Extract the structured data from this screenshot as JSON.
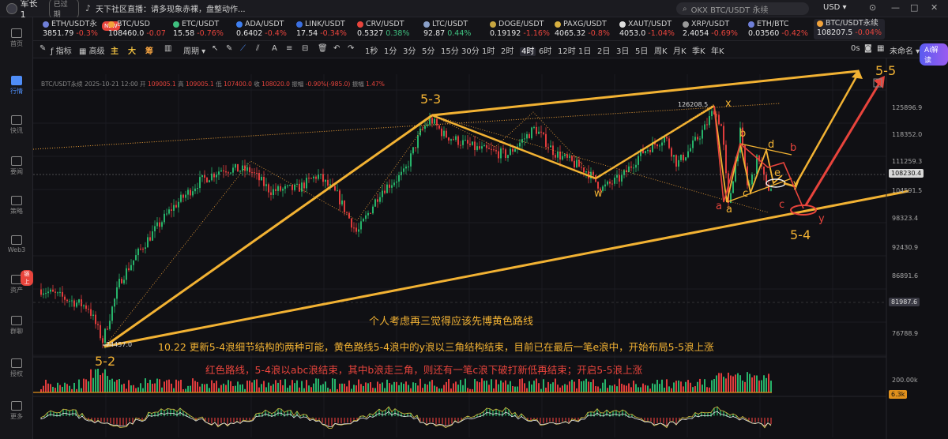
{
  "titlebar": {
    "user": "军长1",
    "expired": "已过期",
    "live": "天下社区直播：请多现象赤裸，盘整动作...",
    "search_placeholder": "OKX BTC/USDT 永续",
    "currency": "USD"
  },
  "sidebar": [
    {
      "label": "首页",
      "icon": "home-icon"
    },
    {
      "label": "行情",
      "icon": "chart-icon",
      "active": true
    },
    {
      "label": "快讯",
      "icon": "news-icon"
    },
    {
      "label": "要闻",
      "icon": "article-icon"
    },
    {
      "label": "策略",
      "icon": "strategy-icon"
    },
    {
      "label": "Web3",
      "icon": "web3-icon"
    },
    {
      "label": "资产",
      "icon": "wallet-icon",
      "badge": "链上"
    },
    {
      "label": "群聊",
      "icon": "chat-icon"
    },
    {
      "label": "授权",
      "icon": "auth-icon"
    },
    {
      "label": "更多",
      "icon": "more-icon"
    }
  ],
  "tickers": [
    {
      "sym": "ETH/USDT永",
      "price": "3851.79",
      "chg": "-0.3%",
      "dir": "dn",
      "color": "#6f7fd8",
      "badge": "NEW"
    },
    {
      "sym": "BTC/USD",
      "price": "108460.0",
      "chg": "-0.07",
      "dir": "dn",
      "color": "#f2a33a"
    },
    {
      "sym": "ETC/USDT",
      "price": "15.58",
      "chg": "-0.76%",
      "dir": "dn",
      "color": "#3fbf7f"
    },
    {
      "sym": "ADA/USDT",
      "price": "0.6402",
      "chg": "-0.4%",
      "dir": "dn",
      "color": "#3f7ff0"
    },
    {
      "sym": "LINK/USDT",
      "price": "17.54",
      "chg": "-0.34%",
      "dir": "dn",
      "color": "#3b6fe0"
    },
    {
      "sym": "CRV/USDT",
      "price": "0.5327",
      "chg": "0.38%",
      "dir": "up",
      "color": "#e8443c"
    },
    {
      "sym": "LTC/USDT",
      "price": "92.87",
      "chg": "0.44%",
      "dir": "up",
      "color": "#8aa0c8"
    },
    {
      "sym": "DOGE/USDT",
      "price": "0.19192",
      "chg": "-1.16%",
      "dir": "dn",
      "color": "#c8a640"
    },
    {
      "sym": "PAXG/USDT",
      "price": "4065.32",
      "chg": "-0.8%",
      "dir": "dn",
      "color": "#d8b040"
    },
    {
      "sym": "XAUT/USDT",
      "price": "4053.0",
      "chg": "-1.04%",
      "dir": "dn",
      "color": "#dddddd"
    },
    {
      "sym": "XRP/USDT",
      "price": "2.4054",
      "chg": "-0.69%",
      "dir": "dn",
      "color": "#999999"
    },
    {
      "sym": "ETH/BTC",
      "price": "0.03560",
      "chg": "-0.42%",
      "dir": "dn",
      "color": "#6f7fd8"
    },
    {
      "sym": "BTC/USDT永续",
      "price": "108207.5",
      "chg": "-0.04%",
      "dir": "dn",
      "color": "#f2a33a",
      "selected": true
    }
  ],
  "toolbar": {
    "indicators": "指标",
    "advanced": "高级",
    "multi": "多窗",
    "replay": "复盘",
    "main": "主",
    "big": "大",
    "chou": "筹",
    "timeframes": [
      "1秒",
      "1分",
      "3分",
      "5分",
      "15分",
      "30分",
      "1时",
      "2时",
      "4时",
      "6时",
      "12时",
      "1日",
      "2日",
      "3日",
      "5日",
      "周K",
      "月K",
      "季K",
      "年K"
    ],
    "selected_tf": "4时",
    "zero_s": "0s",
    "unnamed": "未命名",
    "ai": "Ai解读"
  },
  "chart": {
    "symbol": "BTC/USDT永续",
    "datetime": "2025-10-21 12:00",
    "open_label": "开",
    "open": "109005.1",
    "high_label": "高",
    "high": "109005.1",
    "low_label": "低",
    "low": "107400.0",
    "close_label": "收",
    "close": "108020.0",
    "amp_label": "振幅",
    "amp": "-0.90%(-985.0)",
    "range_label": "振幅",
    "range": "1.47%",
    "price_axis": [
      "125896.9",
      "118352.0",
      "111259.3",
      "104591.5",
      "98323.4",
      "92430.9",
      "86891.6",
      "76788.9"
    ],
    "current_price": "108230.4",
    "crosshair_price": "81987.6",
    "high_mark": "126208.5",
    "low_mark": "74457.0",
    "vol_axis": "200.00k",
    "vol_tag": "6.3k",
    "wave_labels": {
      "w53": "5-3",
      "w52": "5-2",
      "w54": "5-4",
      "w55": "5-5",
      "x": "x",
      "w": "w",
      "a1": "a",
      "a2": "a",
      "b1": "b",
      "b2": "b",
      "c1": "c",
      "c2": "c",
      "d": "d",
      "e": "e",
      "y1": "y",
      "y2": "y"
    },
    "note1": "个人考虑再三觉得应该先博黄色路线",
    "note2": "10.22 更新5-4浪细节结构的两种可能，黄色路线5-4浪中的y浪以三角结构结束，目前已在最后一笔e浪中，开始布局5-5浪上涨",
    "note3": "红色路线，5-4浪以abc浪结束，其中b浪走三角，则还有一笔c浪下破打新低再结束；开启5-5浪上涨"
  }
}
